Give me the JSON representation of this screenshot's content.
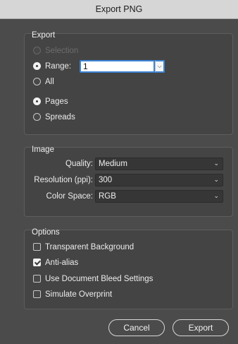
{
  "window": {
    "title": "Export PNG"
  },
  "export_group": {
    "title": "Export",
    "selection_label": "Selection",
    "range_label": "Range:",
    "range_value": "1",
    "all_label": "All",
    "pages_label": "Pages",
    "spreads_label": "Spreads",
    "selected_scope": "Range",
    "selected_layout": "Pages"
  },
  "image_group": {
    "title": "Image",
    "quality_label": "Quality:",
    "quality_value": "Medium",
    "resolution_label": "Resolution (ppi):",
    "resolution_value": "300",
    "color_space_label": "Color Space:",
    "color_space_value": "RGB"
  },
  "options_group": {
    "title": "Options",
    "items": [
      {
        "label": "Transparent Background",
        "checked": false
      },
      {
        "label": "Anti-alias",
        "checked": true
      },
      {
        "label": "Use Document Bleed Settings",
        "checked": false
      },
      {
        "label": "Simulate Overprint",
        "checked": false
      }
    ]
  },
  "buttons": {
    "cancel": "Cancel",
    "export": "Export"
  },
  "colors": {
    "dialog_bg": "#4b4b4b",
    "focus_ring": "#3d84d6"
  }
}
